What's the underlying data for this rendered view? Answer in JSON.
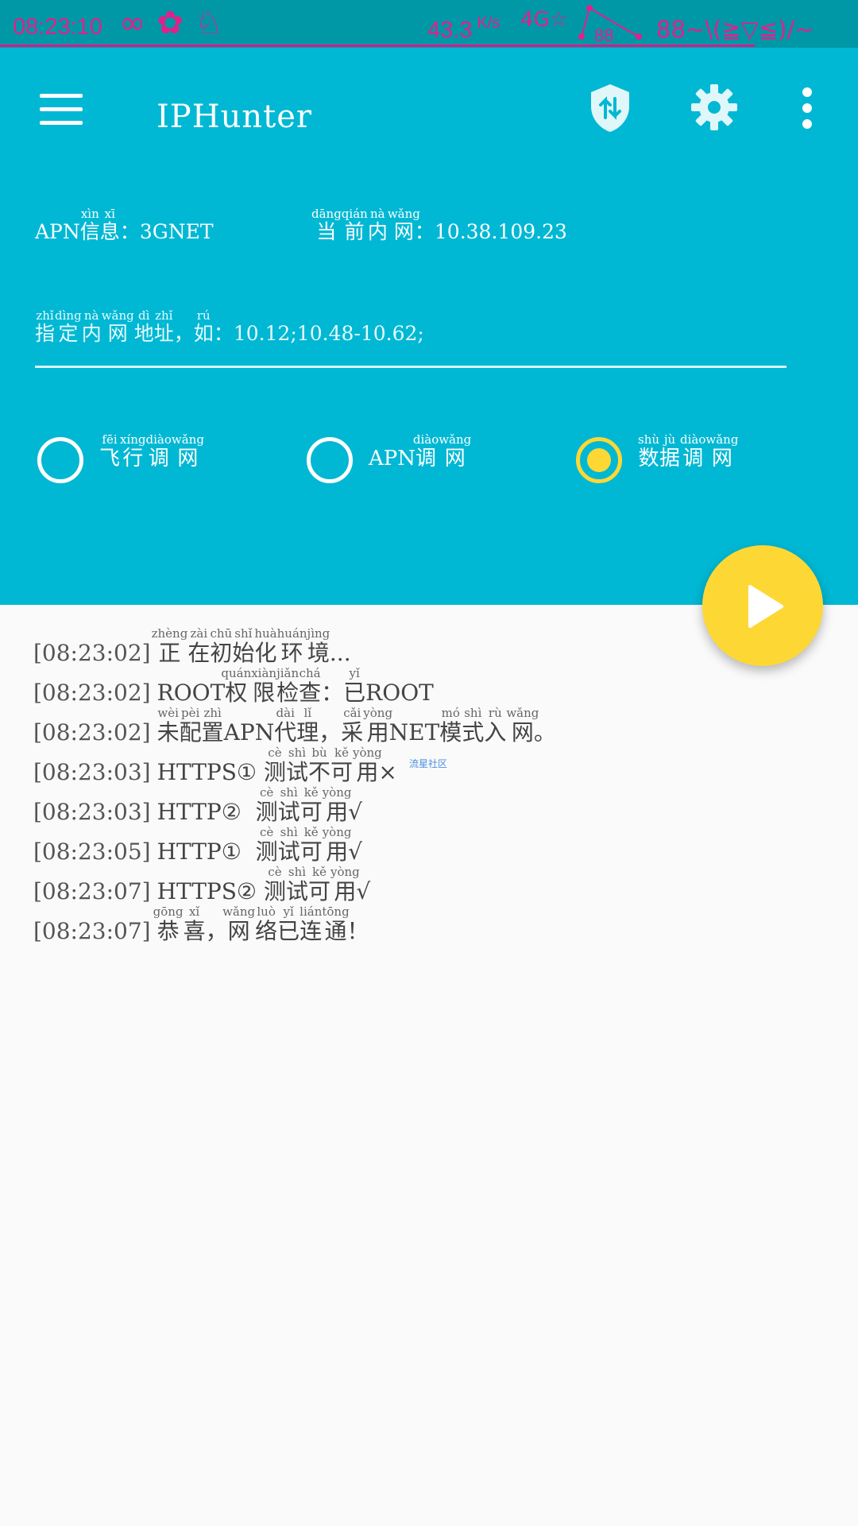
{
  "status_bar": {
    "time": "08:23:10",
    "speed": "43.3",
    "speed_unit": "K/s",
    "signal_label": "4G",
    "battery": "88",
    "kaomoji": "88~\\(≧▽≦)/~",
    "accent_color": "#e0218a",
    "icons": [
      "infinity-icon",
      "clover-icon",
      "qq-penguin-icon",
      "wifi-icon",
      "signal-icon",
      "battery-icon"
    ]
  },
  "header": {
    "title": "IPHunter",
    "background_color": "#00b8d4",
    "icons": [
      "menu-icon",
      "shield-transfer-icon",
      "gear-icon",
      "more-vertical-icon"
    ]
  },
  "info": {
    "apn": {
      "prefix": "APN",
      "chars": [
        {
          "c": "信",
          "p": "xìn"
        },
        {
          "c": "息",
          "p": "xī"
        }
      ],
      "sep": "：",
      "value": "3GNET"
    },
    "net": {
      "chars": [
        {
          "c": "当",
          "p": "dāng"
        },
        {
          "c": "前",
          "p": "qián"
        },
        {
          "c": "内",
          "p": "nà"
        },
        {
          "c": "网",
          "p": "wǎng"
        }
      ],
      "sep": "：",
      "value": "10.38.109.23"
    }
  },
  "address_input": {
    "placeholder_chars": [
      {
        "c": "指",
        "p": "zhǐ"
      },
      {
        "c": "定",
        "p": "dìng"
      },
      {
        "c": "内",
        "p": "nà"
      },
      {
        "c": "网",
        "p": "wǎng"
      },
      {
        "c": "地",
        "p": "dì"
      },
      {
        "c": "址",
        "p": "zhǐ"
      },
      {
        "c": "，",
        "p": ""
      },
      {
        "c": "如",
        "p": "rú"
      }
    ],
    "placeholder_tail": "：10.12;10.48-10.62;",
    "value": ""
  },
  "modes": [
    {
      "prefix": "",
      "chars": [
        {
          "c": "飞",
          "p": "fēi"
        },
        {
          "c": "行",
          "p": "xíng"
        },
        {
          "c": "调",
          "p": "diào"
        },
        {
          "c": "网",
          "p": "wǎng"
        }
      ],
      "checked": false
    },
    {
      "prefix": "APN",
      "chars": [
        {
          "c": "调",
          "p": "diào"
        },
        {
          "c": "网",
          "p": "wǎng"
        }
      ],
      "checked": false
    },
    {
      "prefix": "",
      "chars": [
        {
          "c": "数",
          "p": "shù"
        },
        {
          "c": "据",
          "p": "jù"
        },
        {
          "c": "调",
          "p": "diào"
        },
        {
          "c": "网",
          "p": "wǎng"
        }
      ],
      "checked": true
    }
  ],
  "fab": {
    "icon": "play-icon",
    "color": "#fdd835"
  },
  "log": [
    {
      "ts": "[08:23:02]",
      "parts": [
        {
          "c": "正",
          "p": "zhèng"
        },
        {
          "c": "在",
          "p": "zài"
        },
        {
          "c": "初",
          "p": "chū"
        },
        {
          "c": "始",
          "p": "shǐ"
        },
        {
          "c": "化",
          "p": "huà"
        },
        {
          "c": "环",
          "p": "huán"
        },
        {
          "c": "境",
          "p": "jìng"
        },
        {
          "c": "...",
          "p": ""
        }
      ]
    },
    {
      "ts": "[08:23:02]",
      "parts": [
        {
          "c": "ROOT",
          "p": ""
        },
        {
          "c": "权",
          "p": "quán"
        },
        {
          "c": "限",
          "p": "xiàn"
        },
        {
          "c": "检",
          "p": "jiǎn"
        },
        {
          "c": "查",
          "p": "chá"
        },
        {
          "c": "：",
          "p": ""
        },
        {
          "c": "已",
          "p": "yǐ"
        },
        {
          "c": "ROOT",
          "p": ""
        }
      ]
    },
    {
      "ts": "[08:23:02]",
      "parts": [
        {
          "c": "未",
          "p": "wèi"
        },
        {
          "c": "配",
          "p": "pèi"
        },
        {
          "c": "置",
          "p": "zhì"
        },
        {
          "c": "APN",
          "p": ""
        },
        {
          "c": "代",
          "p": "dài"
        },
        {
          "c": "理",
          "p": "lǐ"
        },
        {
          "c": "，",
          "p": ""
        },
        {
          "c": "采",
          "p": "cǎi"
        },
        {
          "c": "用",
          "p": "yòng"
        },
        {
          "c": "NET",
          "p": ""
        },
        {
          "c": "模",
          "p": "mó"
        },
        {
          "c": "式",
          "p": "shì"
        },
        {
          "c": "入",
          "p": "rù"
        },
        {
          "c": "网",
          "p": "wǎng"
        },
        {
          "c": "。",
          "p": ""
        }
      ]
    },
    {
      "ts": "[08:23:03]",
      "parts": [
        {
          "c": "HTTPS①",
          "p": ""
        },
        {
          "c": " ",
          "p": ""
        },
        {
          "c": "测",
          "p": "cè"
        },
        {
          "c": "试",
          "p": "shì"
        },
        {
          "c": "不",
          "p": "bù"
        },
        {
          "c": "可",
          "p": "kě"
        },
        {
          "c": "用",
          "p": "yòng"
        },
        {
          "c": "×",
          "p": ""
        }
      ]
    },
    {
      "ts": "[08:23:03]",
      "parts": [
        {
          "c": "HTTP②",
          "p": ""
        },
        {
          "c": "  ",
          "p": ""
        },
        {
          "c": "测",
          "p": "cè"
        },
        {
          "c": "试",
          "p": "shì"
        },
        {
          "c": "可",
          "p": "kě"
        },
        {
          "c": "用",
          "p": "yòng"
        },
        {
          "c": "√",
          "p": ""
        }
      ]
    },
    {
      "ts": "[08:23:05]",
      "parts": [
        {
          "c": "HTTP①",
          "p": ""
        },
        {
          "c": "  ",
          "p": ""
        },
        {
          "c": "测",
          "p": "cè"
        },
        {
          "c": "试",
          "p": "shì"
        },
        {
          "c": "可",
          "p": "kě"
        },
        {
          "c": "用",
          "p": "yòng"
        },
        {
          "c": "√",
          "p": ""
        }
      ]
    },
    {
      "ts": "[08:23:07]",
      "parts": [
        {
          "c": "HTTPS②",
          "p": ""
        },
        {
          "c": " ",
          "p": ""
        },
        {
          "c": "测",
          "p": "cè"
        },
        {
          "c": "试",
          "p": "shì"
        },
        {
          "c": "可",
          "p": "kě"
        },
        {
          "c": "用",
          "p": "yòng"
        },
        {
          "c": "√",
          "p": ""
        }
      ]
    },
    {
      "ts": "[08:23:07]",
      "parts": [
        {
          "c": "恭",
          "p": "gōng"
        },
        {
          "c": "喜",
          "p": "xǐ"
        },
        {
          "c": "，",
          "p": ""
        },
        {
          "c": "网",
          "p": "wǎng"
        },
        {
          "c": "络",
          "p": "luò"
        },
        {
          "c": "已",
          "p": "yǐ"
        },
        {
          "c": "连",
          "p": "lián"
        },
        {
          "c": "通",
          "p": "tōng"
        },
        {
          "c": "！",
          "p": ""
        }
      ]
    }
  ],
  "watermark": "流星社区"
}
